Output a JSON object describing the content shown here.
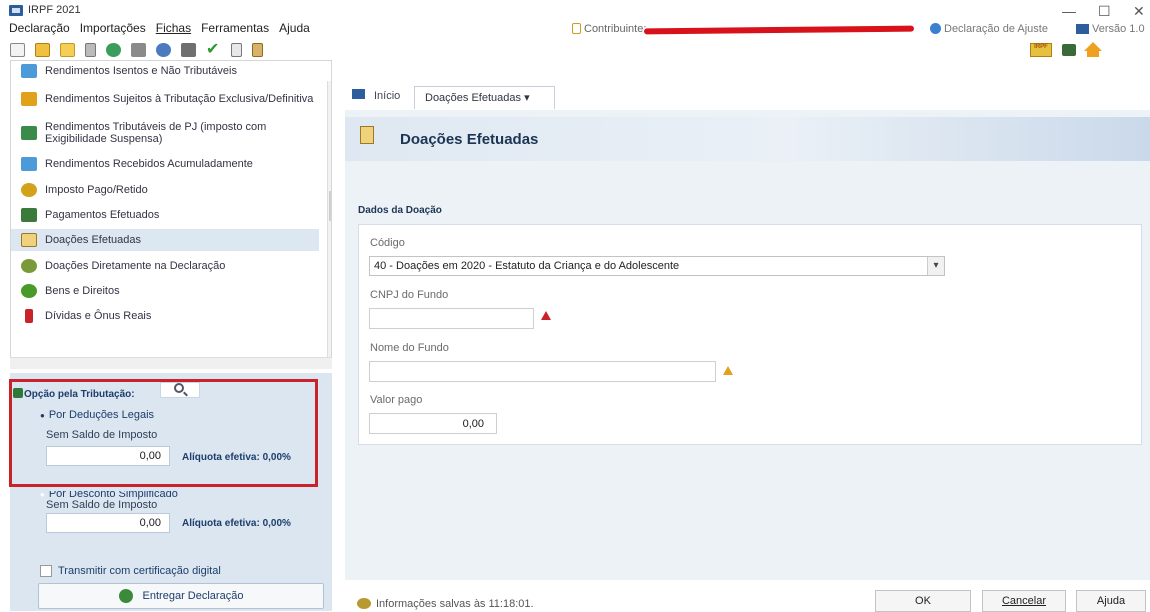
{
  "window": {
    "title": "IRPF 2021",
    "minimize": "—",
    "maximize": "☐",
    "close": "✕"
  },
  "menu": {
    "declaracao": "Declaração",
    "importacoes": "Importações",
    "fichas": "Fichas",
    "ferramentas": "Ferramentas",
    "ajuda": "Ajuda"
  },
  "topbar": {
    "contribuinte": "Contribuinte:",
    "declaracao_ajuste": "Declaração de Ajuste",
    "versao": "Versão 1.0"
  },
  "toolbar_icons": [
    "new-doc-icon",
    "open-icon",
    "folder-icon",
    "trash-icon",
    "network-icon",
    "wrench-icon",
    "disc-icon",
    "printer-icon",
    "check-icon",
    "book-icon",
    "clipboard-icon"
  ],
  "nav": {
    "items": [
      {
        "label": "Rendimentos Isentos e Não Tributáveis",
        "icon": "income-exempt-icon",
        "color": "#4c9ad8"
      },
      {
        "label": "Rendimentos Sujeitos à Tributação Exclusiva/Definitiva",
        "icon": "income-exclusive-icon",
        "color": "#e2a11a"
      },
      {
        "label": "Rendimentos Tributáveis de PJ (imposto com Exigibilidade Suspensa)",
        "icon": "income-suspended-icon",
        "color": "#3a8a4a"
      },
      {
        "label": "Rendimentos Recebidos Acumuladamente",
        "icon": "income-accumulated-icon",
        "color": "#4c9ad8"
      },
      {
        "label": "Imposto Pago/Retido",
        "icon": "tax-paid-icon",
        "color": "#d4a11a"
      },
      {
        "label": "Pagamentos Efetuados",
        "icon": "payments-icon",
        "color": "#3a7a3a"
      },
      {
        "label": "Doações Efetuadas",
        "icon": "donations-icon",
        "color": "#f0d27a"
      },
      {
        "label": "Doações Diretamente na Declaração",
        "icon": "donations-direct-icon",
        "color": "#7a9a3a"
      },
      {
        "label": "Bens e Direitos",
        "icon": "assets-icon",
        "color": "#4a9a2a"
      },
      {
        "label": "Dívidas e Ônus Reais",
        "icon": "debts-icon",
        "color": "#c8232b"
      }
    ]
  },
  "tax_option": {
    "label": "Opção pela Tributação:",
    "legal_deductions": "Por Deduções Legais",
    "simplified": "Por Desconto Simplificado",
    "sem_saldo_1": "Sem Saldo de Imposto",
    "value_1": "0,00",
    "aliquota_1": "Alíquota efetiva: 0,00%",
    "sem_saldo_2": "Sem Saldo de Imposto",
    "value_2": "0,00",
    "aliquota_2": "Alíquota efetiva: 0,00%",
    "cert_label": "Transmitir com certificação digital",
    "entregar": "Entregar Declaração"
  },
  "tabs": {
    "inicio": "Início",
    "doacoes": "Doações Efetuadas  ▾"
  },
  "page": {
    "title": "Doações Efetuadas",
    "section": "Dados da Doação",
    "codigo_label": "Código",
    "codigo_value": "40 - Doações em 2020 - Estatuto da Criança e do Adolescente",
    "cnpj_label": "CNPJ do Fundo",
    "cnpj_value": "",
    "nome_label": "Nome do Fundo",
    "nome_value": "",
    "valor_label": "Valor pago",
    "valor_value": "0,00"
  },
  "footer": {
    "status": "Informações salvas às 11:18:01.",
    "ok": "OK",
    "cancelar": "Cancelar",
    "ajuda": "Ajuda"
  },
  "colors": {
    "accent": "#1c3554",
    "highlight": "#c8232b",
    "panel": "#dbe6f1"
  }
}
